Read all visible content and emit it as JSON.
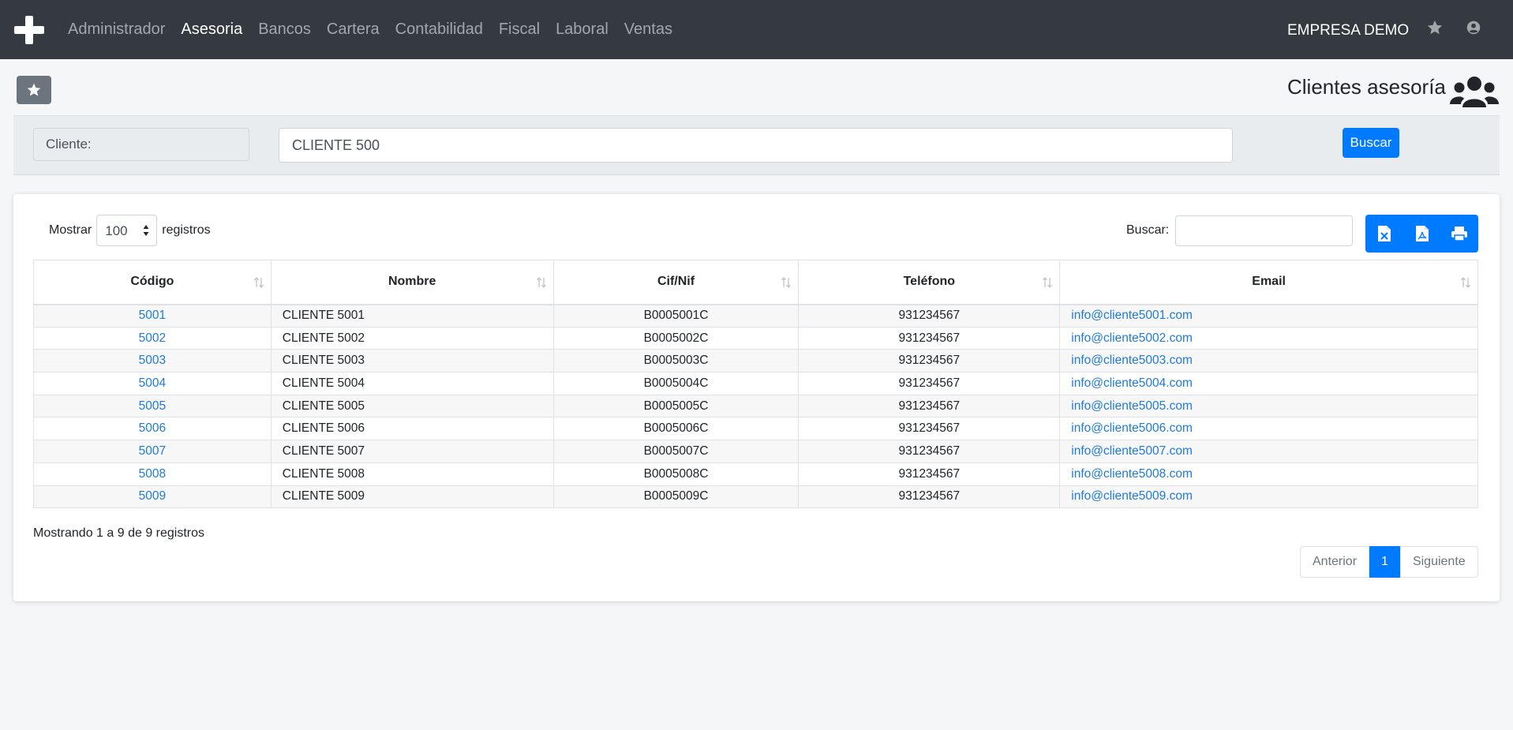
{
  "navbar": {
    "menu": [
      {
        "label": "Administrador",
        "active": false
      },
      {
        "label": "Asesoria",
        "active": true
      },
      {
        "label": "Bancos",
        "active": false
      },
      {
        "label": "Cartera",
        "active": false
      },
      {
        "label": "Contabilidad",
        "active": false
      },
      {
        "label": "Fiscal",
        "active": false
      },
      {
        "label": "Laboral",
        "active": false
      },
      {
        "label": "Ventas",
        "active": false
      }
    ],
    "company": "EMPRESA DEMO",
    "icons": [
      "plus-logo-icon",
      "star-icon",
      "user-circle-icon"
    ]
  },
  "header": {
    "title": "Clientes asesoría",
    "icons": [
      "star-icon",
      "users-icon"
    ]
  },
  "filter": {
    "label": "Cliente:",
    "value": "CLIENTE 500",
    "button": "Buscar"
  },
  "table_controls": {
    "show_prefix": "Mostrar",
    "show_value": "100",
    "show_suffix": "registros",
    "search_label": "Buscar:",
    "export_icons": [
      "excel-file-icon",
      "pdf-file-icon",
      "print-icon"
    ]
  },
  "table": {
    "columns": [
      "Código",
      "Nombre",
      "Cif/Nif",
      "Teléfono",
      "Email"
    ],
    "rows": [
      [
        "5001",
        "CLIENTE 5001",
        "B0005001C",
        "931234567",
        "info@cliente5001.com"
      ],
      [
        "5002",
        "CLIENTE 5002",
        "B0005002C",
        "931234567",
        "info@cliente5002.com"
      ],
      [
        "5003",
        "CLIENTE 5003",
        "B0005003C",
        "931234567",
        "info@cliente5003.com"
      ],
      [
        "5004",
        "CLIENTE 5004",
        "B0005004C",
        "931234567",
        "info@cliente5004.com"
      ],
      [
        "5005",
        "CLIENTE 5005",
        "B0005005C",
        "931234567",
        "info@cliente5005.com"
      ],
      [
        "5006",
        "CLIENTE 5006",
        "B0005006C",
        "931234567",
        "info@cliente5006.com"
      ],
      [
        "5007",
        "CLIENTE 5007",
        "B0005007C",
        "931234567",
        "info@cliente5007.com"
      ],
      [
        "5008",
        "CLIENTE 5008",
        "B0005008C",
        "931234567",
        "info@cliente5008.com"
      ],
      [
        "5009",
        "CLIENTE 5009",
        "B0005009C",
        "931234567",
        "info@cliente5009.com"
      ]
    ]
  },
  "footer": {
    "info": "Mostrando 1 a 9 de 9 registros",
    "prev": "Anterior",
    "current_page": "1",
    "next": "Siguiente"
  },
  "colors": {
    "navbar": "#343a40",
    "primary": "#007bff",
    "link": "#1e7bd8",
    "secondary": "#6c757d"
  }
}
